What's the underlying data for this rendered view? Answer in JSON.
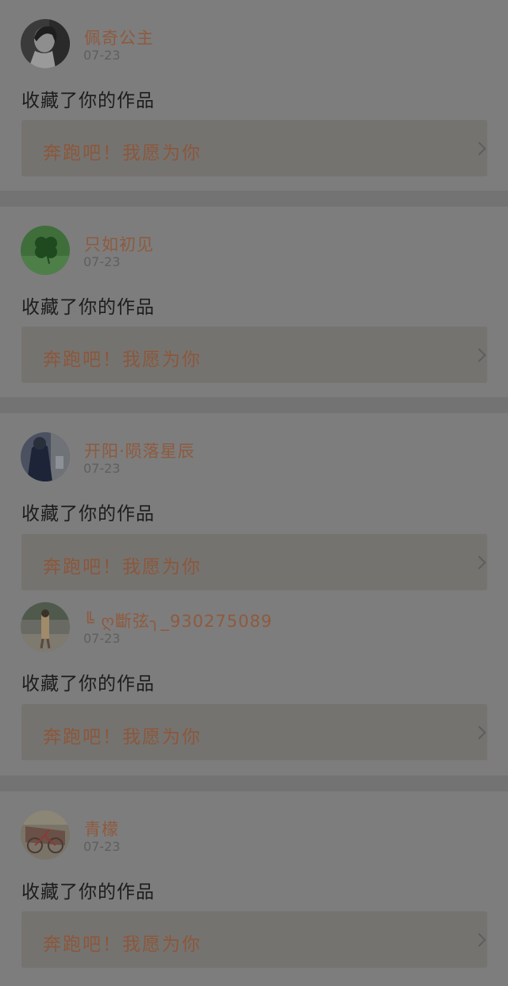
{
  "feed": {
    "items": [
      {
        "username": "佩奇公主",
        "date": "07-23",
        "action": "收藏了你的作品",
        "work_title": "奔跑吧！我愿为你",
        "avatar_icon": "avatar-woman-profile"
      },
      {
        "username": "只如初见",
        "date": "07-23",
        "action": "收藏了你的作品",
        "work_title": "奔跑吧！我愿为你",
        "avatar_icon": "avatar-clover"
      },
      {
        "username": "开阳·陨落星辰",
        "date": "07-23",
        "action": "收藏了你的作品",
        "work_title": "奔跑吧！我愿为你",
        "avatar_icon": "avatar-figure-blue"
      },
      {
        "username": "╚ ღ斷弦╮_930275089",
        "date": "07-23",
        "action": "收藏了你的作品",
        "work_title": "奔跑吧！我愿为你",
        "avatar_icon": "avatar-street-person"
      },
      {
        "username": "青檬",
        "date": "07-23",
        "action": "收藏了你的作品",
        "work_title": "奔跑吧！我愿为你",
        "avatar_icon": "avatar-bicycle"
      }
    ]
  },
  "colors": {
    "background": "#7b7b7b",
    "username": "#8f5a3e",
    "work_title": "#8c573a",
    "action_text": "#1c1c1c",
    "date_text": "#5f5f5f",
    "work_box": "#757370"
  }
}
